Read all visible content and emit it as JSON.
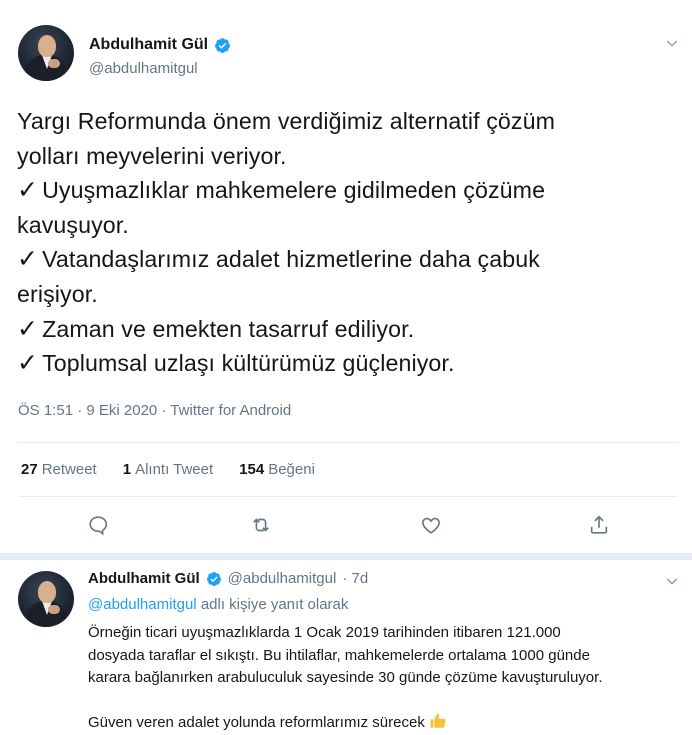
{
  "tweet": {
    "author": {
      "display_name": "Abdulhamit Gül",
      "handle": "@abdulhamitgul",
      "verified": true
    },
    "text_lines": [
      {
        "check": false,
        "text": "Yargı Reformunda önem verdiğimiz alternatif çözüm"
      },
      {
        "check": false,
        "text": "yolları meyvelerini veriyor."
      },
      {
        "check": true,
        "text": "Uyuşmazlıklar mahkemelere gidilmeden çözüme"
      },
      {
        "check": false,
        "text": "kavuşuyor."
      },
      {
        "check": true,
        "text": "Vatandaşlarımız adalet hizmetlerine daha çabuk"
      },
      {
        "check": false,
        "text": "erişiyor."
      },
      {
        "check": true,
        "text": "Zaman ve emekten tasarruf ediliyor."
      },
      {
        "check": true,
        "text": "Toplumsal uzlaşı kültürümüz güçleniyor."
      }
    ],
    "check_glyph": "✓",
    "meta": "ÖS 1:51 · 9 Eki 2020 · Twitter for Android",
    "stats": {
      "retweets": {
        "count": "27",
        "label": "Retweet"
      },
      "quotes": {
        "count": "1",
        "label": "Alıntı Tweet"
      },
      "likes": {
        "count": "154",
        "label": "Beğeni"
      }
    },
    "actions": [
      "reply-icon",
      "retweet-icon",
      "like-icon",
      "share-icon"
    ]
  },
  "reply": {
    "author": {
      "display_name": "Abdulhamit Gül",
      "handle": "@abdulhamitgul",
      "time": "· 7d",
      "verified": true
    },
    "replying_mention": "@abdulhamitgul",
    "replying_suffix": "adlı kişiye yanıt olarak",
    "text_lines": [
      "Örneğin ticari uyuşmazlıklarda 1 Ocak 2019 tarihinden itibaren 121.000",
      "dosyada taraflar el sıkıştı. Bu ihtilaflar, mahkemelerde ortalama 1000 günde",
      "karara bağlanırken arabuluculuk sayesinde 30 günde çözüme kavuşturuluyor."
    ],
    "closing": "Güven veren adalet yolunda reformlarımız sürecek"
  },
  "colors": {
    "accent": "#1da1f2",
    "secondary_text": "#657786",
    "divider": "#e6ecf0"
  }
}
